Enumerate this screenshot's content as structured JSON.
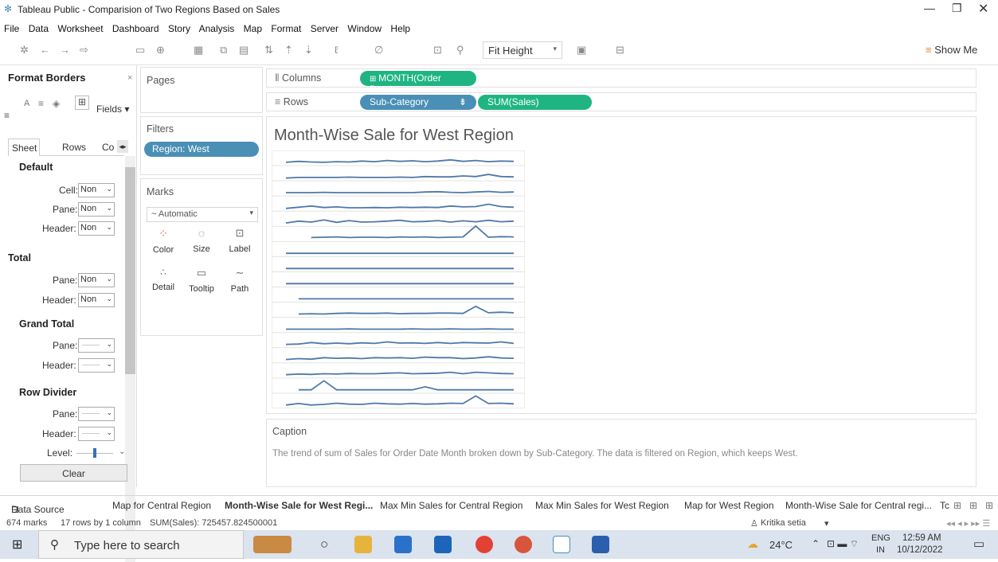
{
  "window": {
    "title": "Tableau Public - Comparision of Two Regions Based on Sales"
  },
  "menu": [
    "File",
    "Data",
    "Worksheet",
    "Dashboard",
    "Story",
    "Analysis",
    "Map",
    "Format",
    "Server",
    "Window",
    "Help"
  ],
  "toolbar": {
    "fit": "Fit Height",
    "show_me": "Show Me"
  },
  "format_pane": {
    "title": "Format Borders",
    "fields_label": "Fields",
    "tabs": [
      "Sheet",
      "Rows",
      "Co"
    ],
    "sections": {
      "default": "Default",
      "total": "Total",
      "grand_total": "Grand Total",
      "row_divider": "Row Divider"
    },
    "labels": {
      "cell": "Cell:",
      "pane": "Pane:",
      "header": "Header:",
      "level": "Level:"
    },
    "none_value": "Non",
    "clear": "Clear"
  },
  "pages": {
    "title": "Pages"
  },
  "filters": {
    "title": "Filters",
    "items": [
      "Region: West"
    ]
  },
  "marks": {
    "title": "Marks",
    "type": "Automatic",
    "buttons": [
      "Color",
      "Size",
      "Label",
      "Detail",
      "Tooltip",
      "Path"
    ]
  },
  "shelves": {
    "columns_label": "Columns",
    "rows_label": "Rows",
    "columns_pill": "MONTH(Order Date)",
    "rows_pill1": "Sub-Category",
    "rows_pill2": "SUM(Sales)"
  },
  "viz": {
    "title": "Month-Wise Sale for West Region"
  },
  "caption": {
    "title": "Caption",
    "text": "The trend of sum of Sales for Order Date Month broken down by Sub-Category. The data is filtered on Region, which keeps West."
  },
  "tabs": {
    "data_source": "Data Source",
    "sheets": [
      "Map for Central Region",
      "Month-Wise Sale for West Regi...",
      "Max Min Sales for Central Region",
      "Max Min Sales for West Region",
      "Map for West Region",
      "Month-Wise Sale for Central regi...",
      "Tc"
    ]
  },
  "status": {
    "marks": "674 marks",
    "rows": "17 rows by 1 column",
    "sum": "SUM(Sales): 725457.824500001",
    "user": "Kritika setia"
  },
  "taskbar": {
    "search_placeholder": "Type here to search",
    "temp": "24°C",
    "lang": "ENG",
    "region": "IN",
    "time": "12:59 AM",
    "date": "10/12/2022"
  },
  "chart_data": {
    "type": "line",
    "title": "Month-Wise Sale for West Region",
    "rows": 17,
    "series": [
      {
        "values": [
          3,
          3.3,
          3.1,
          3.0,
          3.2,
          3.1,
          3.4,
          3.2,
          3.6,
          3.3,
          3.5,
          3.2,
          3.4,
          3.8,
          3.3,
          3.6,
          3.2,
          3.4,
          3.3
        ]
      },
      {
        "values": [
          2.8,
          3,
          3,
          3,
          3,
          3.1,
          3,
          3,
          3,
          3.1,
          3,
          3.3,
          3.2,
          3.2,
          3.5,
          3.3,
          4,
          3.3,
          3.2
        ]
      },
      {
        "values": [
          3,
          3,
          3,
          3.1,
          3,
          3,
          3,
          3,
          3,
          3,
          3,
          3.2,
          3.3,
          3.1,
          3,
          3.2,
          3.4,
          3.1,
          3.2
        ]
      },
      {
        "values": [
          2.8,
          3.2,
          3.6,
          3.1,
          3.3,
          3,
          3,
          3.1,
          3,
          3.2,
          3.1,
          3.2,
          3.1,
          3.6,
          3.3,
          3.4,
          4.2,
          3.4,
          3.2
        ]
      },
      {
        "values": [
          3,
          3.6,
          3.3,
          4,
          3.2,
          3.8,
          3.3,
          3.4,
          3.6,
          3.9,
          3.4,
          3.5,
          3.8,
          3.3,
          3.7,
          3.4,
          3.9,
          3.4,
          3.6
        ]
      },
      {
        "values": [
          null,
          null,
          3.2,
          3.3,
          3.4,
          3.2,
          3.3,
          3.3,
          3.2,
          3.4,
          3.3,
          3.4,
          3.2,
          3.3,
          3.4,
          7,
          3.3,
          3.5,
          3.4
        ]
      },
      {
        "values": [
          3,
          3,
          3,
          3,
          3,
          3,
          3,
          3,
          3,
          3,
          3,
          3,
          3,
          3,
          3,
          3,
          3,
          3,
          3
        ]
      },
      {
        "values": [
          3,
          3,
          3,
          3,
          3,
          3,
          3,
          3,
          3,
          3,
          3,
          3,
          3,
          3,
          3,
          3,
          3,
          3,
          3
        ]
      },
      {
        "values": [
          3,
          3,
          3,
          3,
          3,
          3,
          3,
          3,
          3,
          3,
          3,
          3,
          3,
          3,
          3,
          3,
          3,
          3,
          3
        ]
      },
      {
        "values": [
          null,
          3,
          3,
          3,
          3,
          3,
          3,
          3,
          3,
          3,
          3,
          3,
          3,
          3,
          3,
          3,
          3,
          3,
          3
        ]
      },
      {
        "values": [
          null,
          3,
          3.1,
          3,
          3.2,
          3.3,
          3.2,
          3.2,
          3.3,
          3.1,
          3.2,
          3.2,
          3.3,
          3.3,
          3.2,
          5.5,
          3.4,
          3.6,
          3.4
        ]
      },
      {
        "values": [
          3,
          3,
          3,
          3,
          3,
          3.1,
          3,
          3,
          3,
          3,
          3.1,
          3,
          3,
          3.1,
          3,
          3,
          3.1,
          3,
          3
        ]
      },
      {
        "values": [
          3,
          3.1,
          3.6,
          3.2,
          3.4,
          3.2,
          3.5,
          3.3,
          3.8,
          3.4,
          3.5,
          3.3,
          3.6,
          3.3,
          3.6,
          3.5,
          3.4,
          3.8,
          3.3
        ]
      },
      {
        "values": [
          3,
          3.3,
          3.1,
          3.6,
          3.4,
          3.5,
          3.3,
          3.6,
          3.5,
          3.6,
          3.4,
          3.8,
          3.6,
          3.6,
          3.3,
          3.5,
          3.9,
          3.5,
          3.4
        ]
      },
      {
        "values": [
          3,
          3.2,
          3.1,
          3.3,
          3.2,
          3.4,
          3.3,
          3.3,
          3.5,
          3.6,
          3.3,
          3.4,
          3.5,
          3.8,
          3.3,
          3.8,
          3.6,
          3.4,
          3.3
        ]
      },
      {
        "values": [
          null,
          3,
          3,
          6,
          3,
          3,
          3,
          3,
          3,
          3,
          3,
          4,
          3,
          3,
          3,
          3,
          3,
          3,
          3
        ]
      },
      {
        "values": [
          3,
          3.5,
          3,
          3.2,
          3.6,
          3.3,
          3.2,
          3.6,
          3.4,
          3.3,
          3.5,
          3.3,
          3.4,
          3.6,
          3.5,
          6,
          3.5,
          3.6,
          3.4
        ]
      }
    ]
  }
}
